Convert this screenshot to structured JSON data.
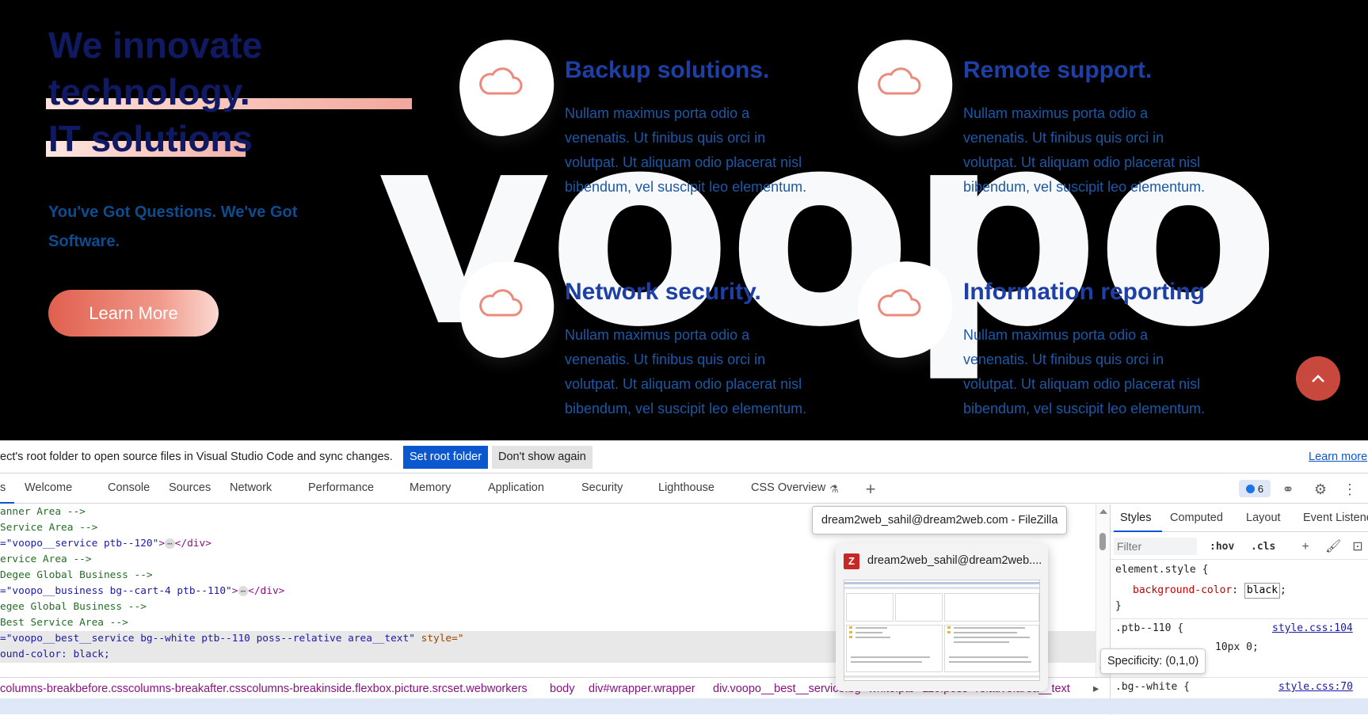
{
  "website": {
    "hero": {
      "title_lines": [
        "We innovate",
        "technology.",
        "IT solutions"
      ],
      "subtitle": "You've Got Questions. We've Got Software.",
      "button": "Learn More"
    },
    "big_word": "voopo",
    "services": [
      {
        "title": "Backup solutions.",
        "text": "Nullam maximus porta odio a venenatis. Ut finibus quis orci in volutpat. Ut aliquam odio placerat nisl bibendum, vel suscipit leo elementum.",
        "icon": "cloud-icon"
      },
      {
        "title": "Remote support.",
        "text": "Nullam maximus porta odio a venenatis. Ut finibus quis orci in volutpat. Ut aliquam odio placerat nisl bibendum, vel suscipit leo elementum.",
        "icon": "cloud-icon"
      },
      {
        "title": "Network security.",
        "text": "Nullam maximus porta odio a venenatis. Ut finibus quis orci in volutpat. Ut aliquam odio placerat nisl bibendum, vel suscipit leo elementum.",
        "icon": "cloud-icon"
      },
      {
        "title": "Information reporting",
        "text": "Nullam maximus porta odio a venenatis. Ut finibus quis orci in volutpat. Ut aliquam odio placerat nisl bibendum, vel suscipit leo elementum.",
        "icon": "cloud-icon"
      }
    ],
    "scroll_top_icon": "chevron-up-icon"
  },
  "devtools": {
    "infobar": {
      "message": "ect's root folder to open source files in Visual Studio Code and sync changes.",
      "set_root": "Set root folder",
      "dont_show": "Don't show again",
      "learn_more": "Learn more"
    },
    "tabs": {
      "first": "s",
      "welcome": "Welcome",
      "console": "Console",
      "sources": "Sources",
      "network": "Network",
      "performance": "Performance",
      "memory": "Memory",
      "application": "Application",
      "security": "Security",
      "lighthouse": "Lighthouse",
      "css_overview": "CSS Overview",
      "issues_count": "6"
    },
    "elements": {
      "l1": "anner Area -->",
      "l2": " Service Area -->",
      "l3_val": "=\"voopo__service ptb--120\"",
      "l3_dots": "⋯",
      "l3_end": "</div>",
      "l4": "ervice Area -->",
      "l5": " Degee Global Business -->",
      "l6_val": "=\"voopo__business bg--cart-4 ptb--110\"",
      "l6_dots": "⋯",
      "l6_end": "</div>",
      "l7": "egee Global Business -->",
      "l8": " Best Service Area -->",
      "l9_val": "=\"voopo__best__service bg--white ptb--110  poss--relative area__text\"",
      "l9_attr": " style=\"",
      "l10": "ound-color: black;"
    },
    "breadcrumbs": {
      "b1": "columns-breakbefore.csscolumns-breakafter.csscolumns-breakinside.flexbox.picture.srcset.webworkers",
      "b2": "body",
      "b3": "div#wrapper.wrapper",
      "b4": "div.voopo__best__service.bg--white.ptb--110.poss--relative.area__text"
    },
    "styles": {
      "tabs": [
        "Styles",
        "Computed",
        "Layout",
        "Event Listene"
      ],
      "filter_placeholder": "Filter",
      "hov": ":hov",
      "cls": ".cls",
      "element_style": "element.style {",
      "prop": "background-color",
      "value": "black",
      "close": "}",
      "rule2_selector": ".ptb--110 {",
      "rule2_src": "style.css:104",
      "rule2_partial": "10px 0;",
      "rule3_selector": ".bg--white {",
      "rule3_src": "style.css:70",
      "tooltip": "Specificity: (0,1,0)"
    }
  },
  "taskbar_popup": {
    "title": "dream2web_sahil@dream2web.com - FileZilla",
    "card_name": "dream2web_sahil@dream2web....",
    "app_icon_letter": "Z"
  }
}
